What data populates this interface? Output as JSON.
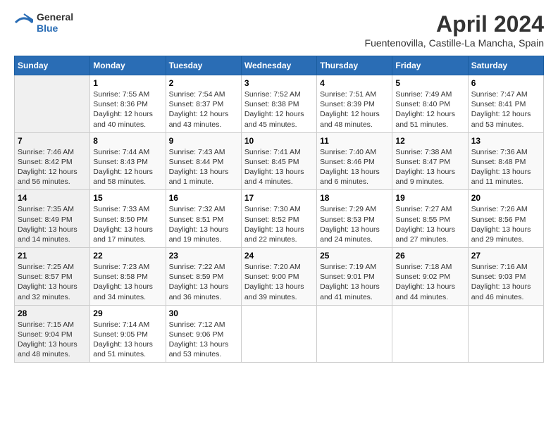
{
  "header": {
    "logo_general": "General",
    "logo_blue": "Blue",
    "title": "April 2024",
    "subtitle": "Fuentenovilla, Castille-La Mancha, Spain"
  },
  "calendar": {
    "days_of_week": [
      "Sunday",
      "Monday",
      "Tuesday",
      "Wednesday",
      "Thursday",
      "Friday",
      "Saturday"
    ],
    "weeks": [
      [
        {
          "day": "",
          "sunrise": "",
          "sunset": "",
          "daylight": ""
        },
        {
          "day": "1",
          "sunrise": "Sunrise: 7:55 AM",
          "sunset": "Sunset: 8:36 PM",
          "daylight": "Daylight: 12 hours and 40 minutes."
        },
        {
          "day": "2",
          "sunrise": "Sunrise: 7:54 AM",
          "sunset": "Sunset: 8:37 PM",
          "daylight": "Daylight: 12 hours and 43 minutes."
        },
        {
          "day": "3",
          "sunrise": "Sunrise: 7:52 AM",
          "sunset": "Sunset: 8:38 PM",
          "daylight": "Daylight: 12 hours and 45 minutes."
        },
        {
          "day": "4",
          "sunrise": "Sunrise: 7:51 AM",
          "sunset": "Sunset: 8:39 PM",
          "daylight": "Daylight: 12 hours and 48 minutes."
        },
        {
          "day": "5",
          "sunrise": "Sunrise: 7:49 AM",
          "sunset": "Sunset: 8:40 PM",
          "daylight": "Daylight: 12 hours and 51 minutes."
        },
        {
          "day": "6",
          "sunrise": "Sunrise: 7:47 AM",
          "sunset": "Sunset: 8:41 PM",
          "daylight": "Daylight: 12 hours and 53 minutes."
        }
      ],
      [
        {
          "day": "7",
          "sunrise": "Sunrise: 7:46 AM",
          "sunset": "Sunset: 8:42 PM",
          "daylight": "Daylight: 12 hours and 56 minutes."
        },
        {
          "day": "8",
          "sunrise": "Sunrise: 7:44 AM",
          "sunset": "Sunset: 8:43 PM",
          "daylight": "Daylight: 12 hours and 58 minutes."
        },
        {
          "day": "9",
          "sunrise": "Sunrise: 7:43 AM",
          "sunset": "Sunset: 8:44 PM",
          "daylight": "Daylight: 13 hours and 1 minute."
        },
        {
          "day": "10",
          "sunrise": "Sunrise: 7:41 AM",
          "sunset": "Sunset: 8:45 PM",
          "daylight": "Daylight: 13 hours and 4 minutes."
        },
        {
          "day": "11",
          "sunrise": "Sunrise: 7:40 AM",
          "sunset": "Sunset: 8:46 PM",
          "daylight": "Daylight: 13 hours and 6 minutes."
        },
        {
          "day": "12",
          "sunrise": "Sunrise: 7:38 AM",
          "sunset": "Sunset: 8:47 PM",
          "daylight": "Daylight: 13 hours and 9 minutes."
        },
        {
          "day": "13",
          "sunrise": "Sunrise: 7:36 AM",
          "sunset": "Sunset: 8:48 PM",
          "daylight": "Daylight: 13 hours and 11 minutes."
        }
      ],
      [
        {
          "day": "14",
          "sunrise": "Sunrise: 7:35 AM",
          "sunset": "Sunset: 8:49 PM",
          "daylight": "Daylight: 13 hours and 14 minutes."
        },
        {
          "day": "15",
          "sunrise": "Sunrise: 7:33 AM",
          "sunset": "Sunset: 8:50 PM",
          "daylight": "Daylight: 13 hours and 17 minutes."
        },
        {
          "day": "16",
          "sunrise": "Sunrise: 7:32 AM",
          "sunset": "Sunset: 8:51 PM",
          "daylight": "Daylight: 13 hours and 19 minutes."
        },
        {
          "day": "17",
          "sunrise": "Sunrise: 7:30 AM",
          "sunset": "Sunset: 8:52 PM",
          "daylight": "Daylight: 13 hours and 22 minutes."
        },
        {
          "day": "18",
          "sunrise": "Sunrise: 7:29 AM",
          "sunset": "Sunset: 8:53 PM",
          "daylight": "Daylight: 13 hours and 24 minutes."
        },
        {
          "day": "19",
          "sunrise": "Sunrise: 7:27 AM",
          "sunset": "Sunset: 8:55 PM",
          "daylight": "Daylight: 13 hours and 27 minutes."
        },
        {
          "day": "20",
          "sunrise": "Sunrise: 7:26 AM",
          "sunset": "Sunset: 8:56 PM",
          "daylight": "Daylight: 13 hours and 29 minutes."
        }
      ],
      [
        {
          "day": "21",
          "sunrise": "Sunrise: 7:25 AM",
          "sunset": "Sunset: 8:57 PM",
          "daylight": "Daylight: 13 hours and 32 minutes."
        },
        {
          "day": "22",
          "sunrise": "Sunrise: 7:23 AM",
          "sunset": "Sunset: 8:58 PM",
          "daylight": "Daylight: 13 hours and 34 minutes."
        },
        {
          "day": "23",
          "sunrise": "Sunrise: 7:22 AM",
          "sunset": "Sunset: 8:59 PM",
          "daylight": "Daylight: 13 hours and 36 minutes."
        },
        {
          "day": "24",
          "sunrise": "Sunrise: 7:20 AM",
          "sunset": "Sunset: 9:00 PM",
          "daylight": "Daylight: 13 hours and 39 minutes."
        },
        {
          "day": "25",
          "sunrise": "Sunrise: 7:19 AM",
          "sunset": "Sunset: 9:01 PM",
          "daylight": "Daylight: 13 hours and 41 minutes."
        },
        {
          "day": "26",
          "sunrise": "Sunrise: 7:18 AM",
          "sunset": "Sunset: 9:02 PM",
          "daylight": "Daylight: 13 hours and 44 minutes."
        },
        {
          "day": "27",
          "sunrise": "Sunrise: 7:16 AM",
          "sunset": "Sunset: 9:03 PM",
          "daylight": "Daylight: 13 hours and 46 minutes."
        }
      ],
      [
        {
          "day": "28",
          "sunrise": "Sunrise: 7:15 AM",
          "sunset": "Sunset: 9:04 PM",
          "daylight": "Daylight: 13 hours and 48 minutes."
        },
        {
          "day": "29",
          "sunrise": "Sunrise: 7:14 AM",
          "sunset": "Sunset: 9:05 PM",
          "daylight": "Daylight: 13 hours and 51 minutes."
        },
        {
          "day": "30",
          "sunrise": "Sunrise: 7:12 AM",
          "sunset": "Sunset: 9:06 PM",
          "daylight": "Daylight: 13 hours and 53 minutes."
        },
        {
          "day": "",
          "sunrise": "",
          "sunset": "",
          "daylight": ""
        },
        {
          "day": "",
          "sunrise": "",
          "sunset": "",
          "daylight": ""
        },
        {
          "day": "",
          "sunrise": "",
          "sunset": "",
          "daylight": ""
        },
        {
          "day": "",
          "sunrise": "",
          "sunset": "",
          "daylight": ""
        }
      ]
    ]
  }
}
